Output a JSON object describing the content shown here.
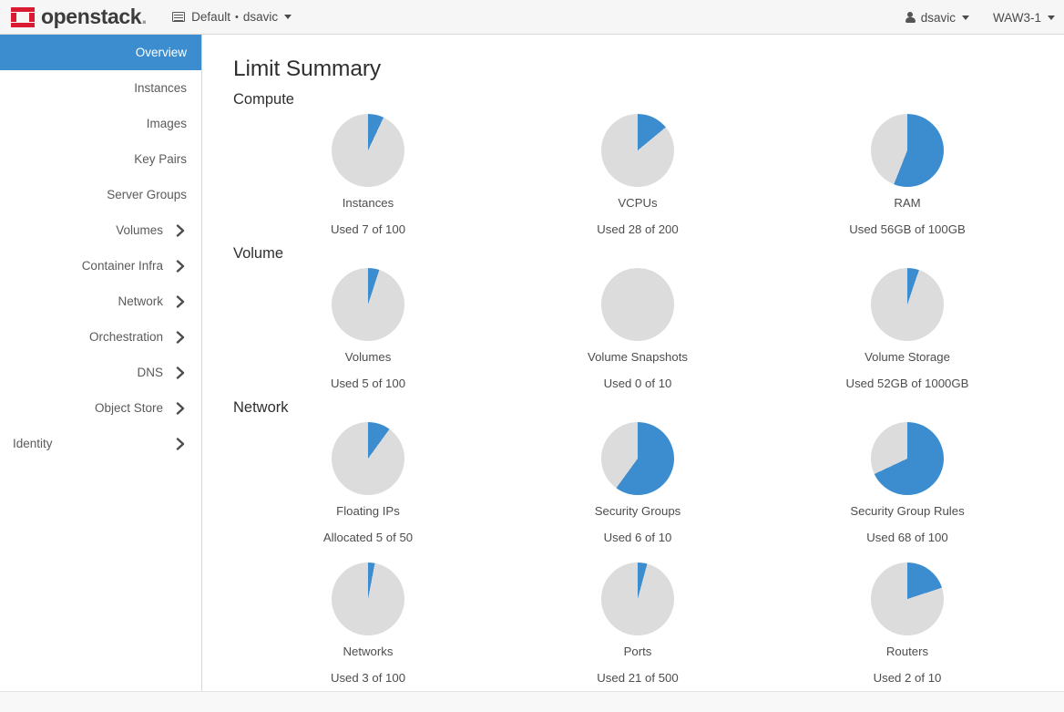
{
  "navbar": {
    "brand_text": "openstack",
    "brand_dot": ".",
    "context": {
      "domain": "Default",
      "separator": "•",
      "project": "dsavic"
    },
    "user": "dsavic",
    "region": "WAW3-1"
  },
  "sidebar": {
    "items": [
      {
        "label": "Overview",
        "active": true,
        "expandable": false
      },
      {
        "label": "Instances",
        "active": false,
        "expandable": false
      },
      {
        "label": "Images",
        "active": false,
        "expandable": false
      },
      {
        "label": "Key Pairs",
        "active": false,
        "expandable": false
      },
      {
        "label": "Server Groups",
        "active": false,
        "expandable": false
      },
      {
        "label": "Volumes",
        "active": false,
        "expandable": true
      },
      {
        "label": "Container Infra",
        "active": false,
        "expandable": true
      },
      {
        "label": "Network",
        "active": false,
        "expandable": true
      },
      {
        "label": "Orchestration",
        "active": false,
        "expandable": true
      },
      {
        "label": "DNS",
        "active": false,
        "expandable": true
      },
      {
        "label": "Object Store",
        "active": false,
        "expandable": true
      },
      {
        "label": "Identity",
        "active": false,
        "expandable": true
      }
    ]
  },
  "main": {
    "page_title": "Limit Summary",
    "sections": [
      {
        "title": "Compute",
        "rows": [
          [
            {
              "name": "Instances",
              "value_text": "Used 7 of 100",
              "used": 7,
              "total": 100,
              "percent": 7
            },
            {
              "name": "VCPUs",
              "value_text": "Used 28 of 200",
              "used": 28,
              "total": 200,
              "percent": 14
            },
            {
              "name": "RAM",
              "value_text": "Used 56GB of 100GB",
              "used": 56,
              "total": 100,
              "percent": 56
            }
          ]
        ]
      },
      {
        "title": "Volume",
        "rows": [
          [
            {
              "name": "Volumes",
              "value_text": "Used 5 of 100",
              "used": 5,
              "total": 100,
              "percent": 5
            },
            {
              "name": "Volume Snapshots",
              "value_text": "Used 0 of 10",
              "used": 0,
              "total": 10,
              "percent": 0
            },
            {
              "name": "Volume Storage",
              "value_text": "Used 52GB of 1000GB",
              "used": 52,
              "total": 1000,
              "percent": 5.2
            }
          ]
        ]
      },
      {
        "title": "Network",
        "rows": [
          [
            {
              "name": "Floating IPs",
              "value_text": "Allocated 5 of 50",
              "used": 5,
              "total": 50,
              "percent": 10
            },
            {
              "name": "Security Groups",
              "value_text": "Used 6 of 10",
              "used": 6,
              "total": 10,
              "percent": 60
            },
            {
              "name": "Security Group Rules",
              "value_text": "Used 68 of 100",
              "used": 68,
              "total": 100,
              "percent": 68
            }
          ],
          [
            {
              "name": "Networks",
              "value_text": "Used 3 of 100",
              "used": 3,
              "total": 100,
              "percent": 3
            },
            {
              "name": "Ports",
              "value_text": "Used 21 of 500",
              "used": 21,
              "total": 500,
              "percent": 4.2
            },
            {
              "name": "Routers",
              "value_text": "Used 2 of 10",
              "used": 2,
              "total": 10,
              "percent": 20
            }
          ]
        ]
      }
    ]
  },
  "chart_data": {
    "type": "pie",
    "title": "Limit Summary",
    "legend_position": "none",
    "colors": {
      "used": "#3c8dcf",
      "remaining": "#dcdcdc"
    },
    "charts": [
      {
        "group": "Compute",
        "label": "Instances",
        "used": 7,
        "total": 100,
        "percent": 7,
        "unit": "",
        "caption": "Used 7 of 100"
      },
      {
        "group": "Compute",
        "label": "VCPUs",
        "used": 28,
        "total": 200,
        "percent": 14,
        "unit": "",
        "caption": "Used 28 of 200"
      },
      {
        "group": "Compute",
        "label": "RAM",
        "used": 56,
        "total": 100,
        "percent": 56,
        "unit": "GB",
        "caption": "Used 56GB of 100GB"
      },
      {
        "group": "Volume",
        "label": "Volumes",
        "used": 5,
        "total": 100,
        "percent": 5,
        "unit": "",
        "caption": "Used 5 of 100"
      },
      {
        "group": "Volume",
        "label": "Volume Snapshots",
        "used": 0,
        "total": 10,
        "percent": 0,
        "unit": "",
        "caption": "Used 0 of 10"
      },
      {
        "group": "Volume",
        "label": "Volume Storage",
        "used": 52,
        "total": 1000,
        "percent": 5.2,
        "unit": "GB",
        "caption": "Used 52GB of 1000GB"
      },
      {
        "group": "Network",
        "label": "Floating IPs",
        "used": 5,
        "total": 50,
        "percent": 10,
        "unit": "",
        "caption": "Allocated 5 of 50"
      },
      {
        "group": "Network",
        "label": "Security Groups",
        "used": 6,
        "total": 10,
        "percent": 60,
        "unit": "",
        "caption": "Used 6 of 10"
      },
      {
        "group": "Network",
        "label": "Security Group Rules",
        "used": 68,
        "total": 100,
        "percent": 68,
        "unit": "",
        "caption": "Used 68 of 100"
      },
      {
        "group": "Network",
        "label": "Networks",
        "used": 3,
        "total": 100,
        "percent": 3,
        "unit": "",
        "caption": "Used 3 of 100"
      },
      {
        "group": "Network",
        "label": "Ports",
        "used": 21,
        "total": 500,
        "percent": 4.2,
        "unit": "",
        "caption": "Used 21 of 500"
      },
      {
        "group": "Network",
        "label": "Routers",
        "used": 2,
        "total": 10,
        "percent": 20,
        "unit": "",
        "caption": "Used 2 of 10"
      }
    ]
  }
}
